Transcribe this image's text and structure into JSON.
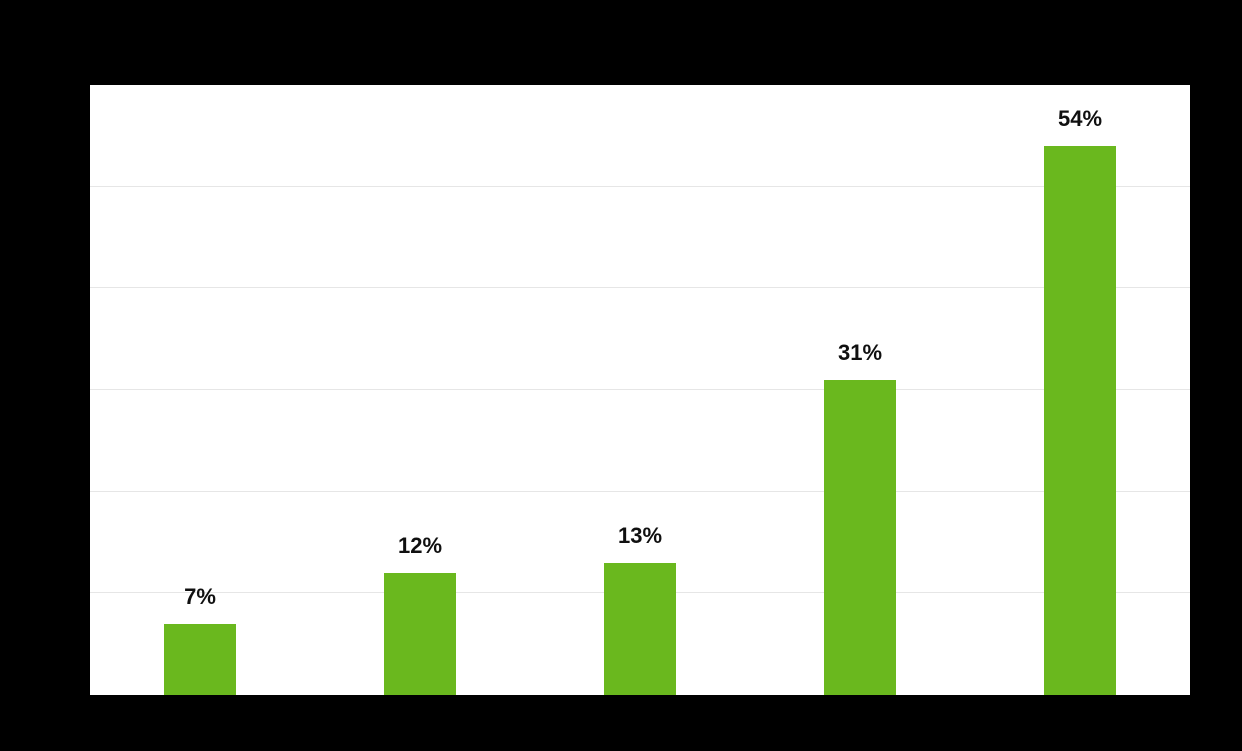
{
  "chart_data": {
    "type": "bar",
    "categories": [
      "",
      "",
      "",
      "",
      ""
    ],
    "values": [
      7,
      12,
      13,
      31,
      54
    ],
    "value_labels": [
      "7%",
      "12%",
      "13%",
      "31%",
      "54%"
    ],
    "title": "",
    "xlabel": "",
    "ylabel": "",
    "ylim": [
      0,
      60
    ],
    "grid_step": 10,
    "bar_color": "#6ab81e",
    "background": "#000000",
    "plot_background": "#ffffff"
  }
}
